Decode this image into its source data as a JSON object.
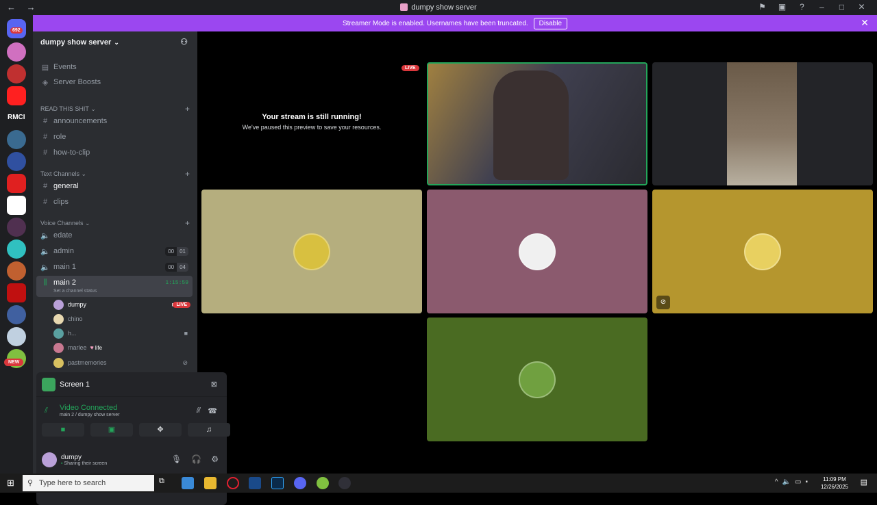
{
  "window": {
    "title": "dumpy show server",
    "nav": "← →"
  },
  "banner": {
    "text": "Streamer Mode is enabled. Usernames have been truncated.",
    "button": "Disable"
  },
  "guilds": {
    "badge": "692",
    "rmci": "RMCI",
    "new": "NEW"
  },
  "server": {
    "name": "dumpy show server",
    "menu": [
      {
        "label": "Events",
        "icon": "calendar-icon"
      },
      {
        "label": "Server Boosts",
        "icon": "boost-icon"
      }
    ]
  },
  "categories": [
    {
      "label": "READ THIS SHIT"
    },
    {
      "label": "Text Channels"
    },
    {
      "label": "Voice Channels"
    }
  ],
  "read_channels": [
    "announcements",
    "role",
    "how-to-clip"
  ],
  "text_channels": [
    "general",
    "clips"
  ],
  "voice_channels": [
    {
      "name": "edate"
    },
    {
      "name": "admin",
      "a": "00",
      "b": "01"
    },
    {
      "name": "main 1",
      "a": "00",
      "b": "04"
    },
    {
      "name": "main 2",
      "timer": "1:15:59",
      "status": "Set a channel status"
    }
  ],
  "voice_users": [
    {
      "name": "dumpy",
      "badge": "LIVE",
      "color": "#b9a0d8"
    },
    {
      "name": "chino",
      "color": "#e8d8b0"
    },
    {
      "name": "h...",
      "color": "#5aa0a0"
    },
    {
      "name": "marlee",
      "extra": "life",
      "color": "#c87890"
    },
    {
      "name": "pastmemories",
      "color": "#d8c060"
    }
  ],
  "panel": {
    "screen": "Screen 1",
    "status": "Video Connected",
    "location": "main 2 / dumpy show server",
    "user": "dumpy",
    "user_status": "Sharing their screen"
  },
  "stage": {
    "paused_title": "Your stream is still running!",
    "paused_sub": "We've paused this preview to save your resources.",
    "live": "LIVE"
  },
  "tiles": [
    {
      "color": "#b5ae7e"
    },
    {
      "color": "#8b5a6e"
    },
    {
      "color": "#b5962e"
    },
    {
      "color": "#4a6b22"
    }
  ],
  "taskbar": {
    "search": "Type here to search",
    "time": "11:09 PM",
    "date": "12/26/2025"
  }
}
